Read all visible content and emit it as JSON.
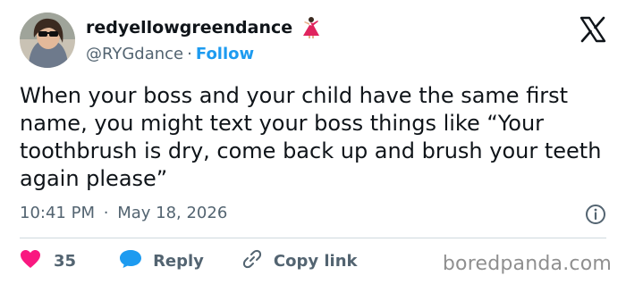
{
  "author": {
    "display_name": "redyellowgreendance",
    "handle": "@RYGdance",
    "separator": "·",
    "follow_label": "Follow"
  },
  "tweet": {
    "text": "When your boss and your child have the same first name, you might text your boss things like “Your toothbrush is dry, come back up and brush your teeth again please”",
    "time": "10:41 PM",
    "separator": "·",
    "date": "May 18, 2026"
  },
  "actions": {
    "like_count": "35",
    "reply_label": "Reply",
    "copy_label": "Copy link"
  },
  "watermark": "boredpanda.com",
  "colors": {
    "like": "#f91880",
    "link": "#1d9bf0",
    "muted": "#536471",
    "text": "#0f1419"
  },
  "icons": [
    "dancer-icon",
    "x-logo-icon",
    "info-icon",
    "heart-icon",
    "reply-bubble-icon",
    "link-icon"
  ]
}
